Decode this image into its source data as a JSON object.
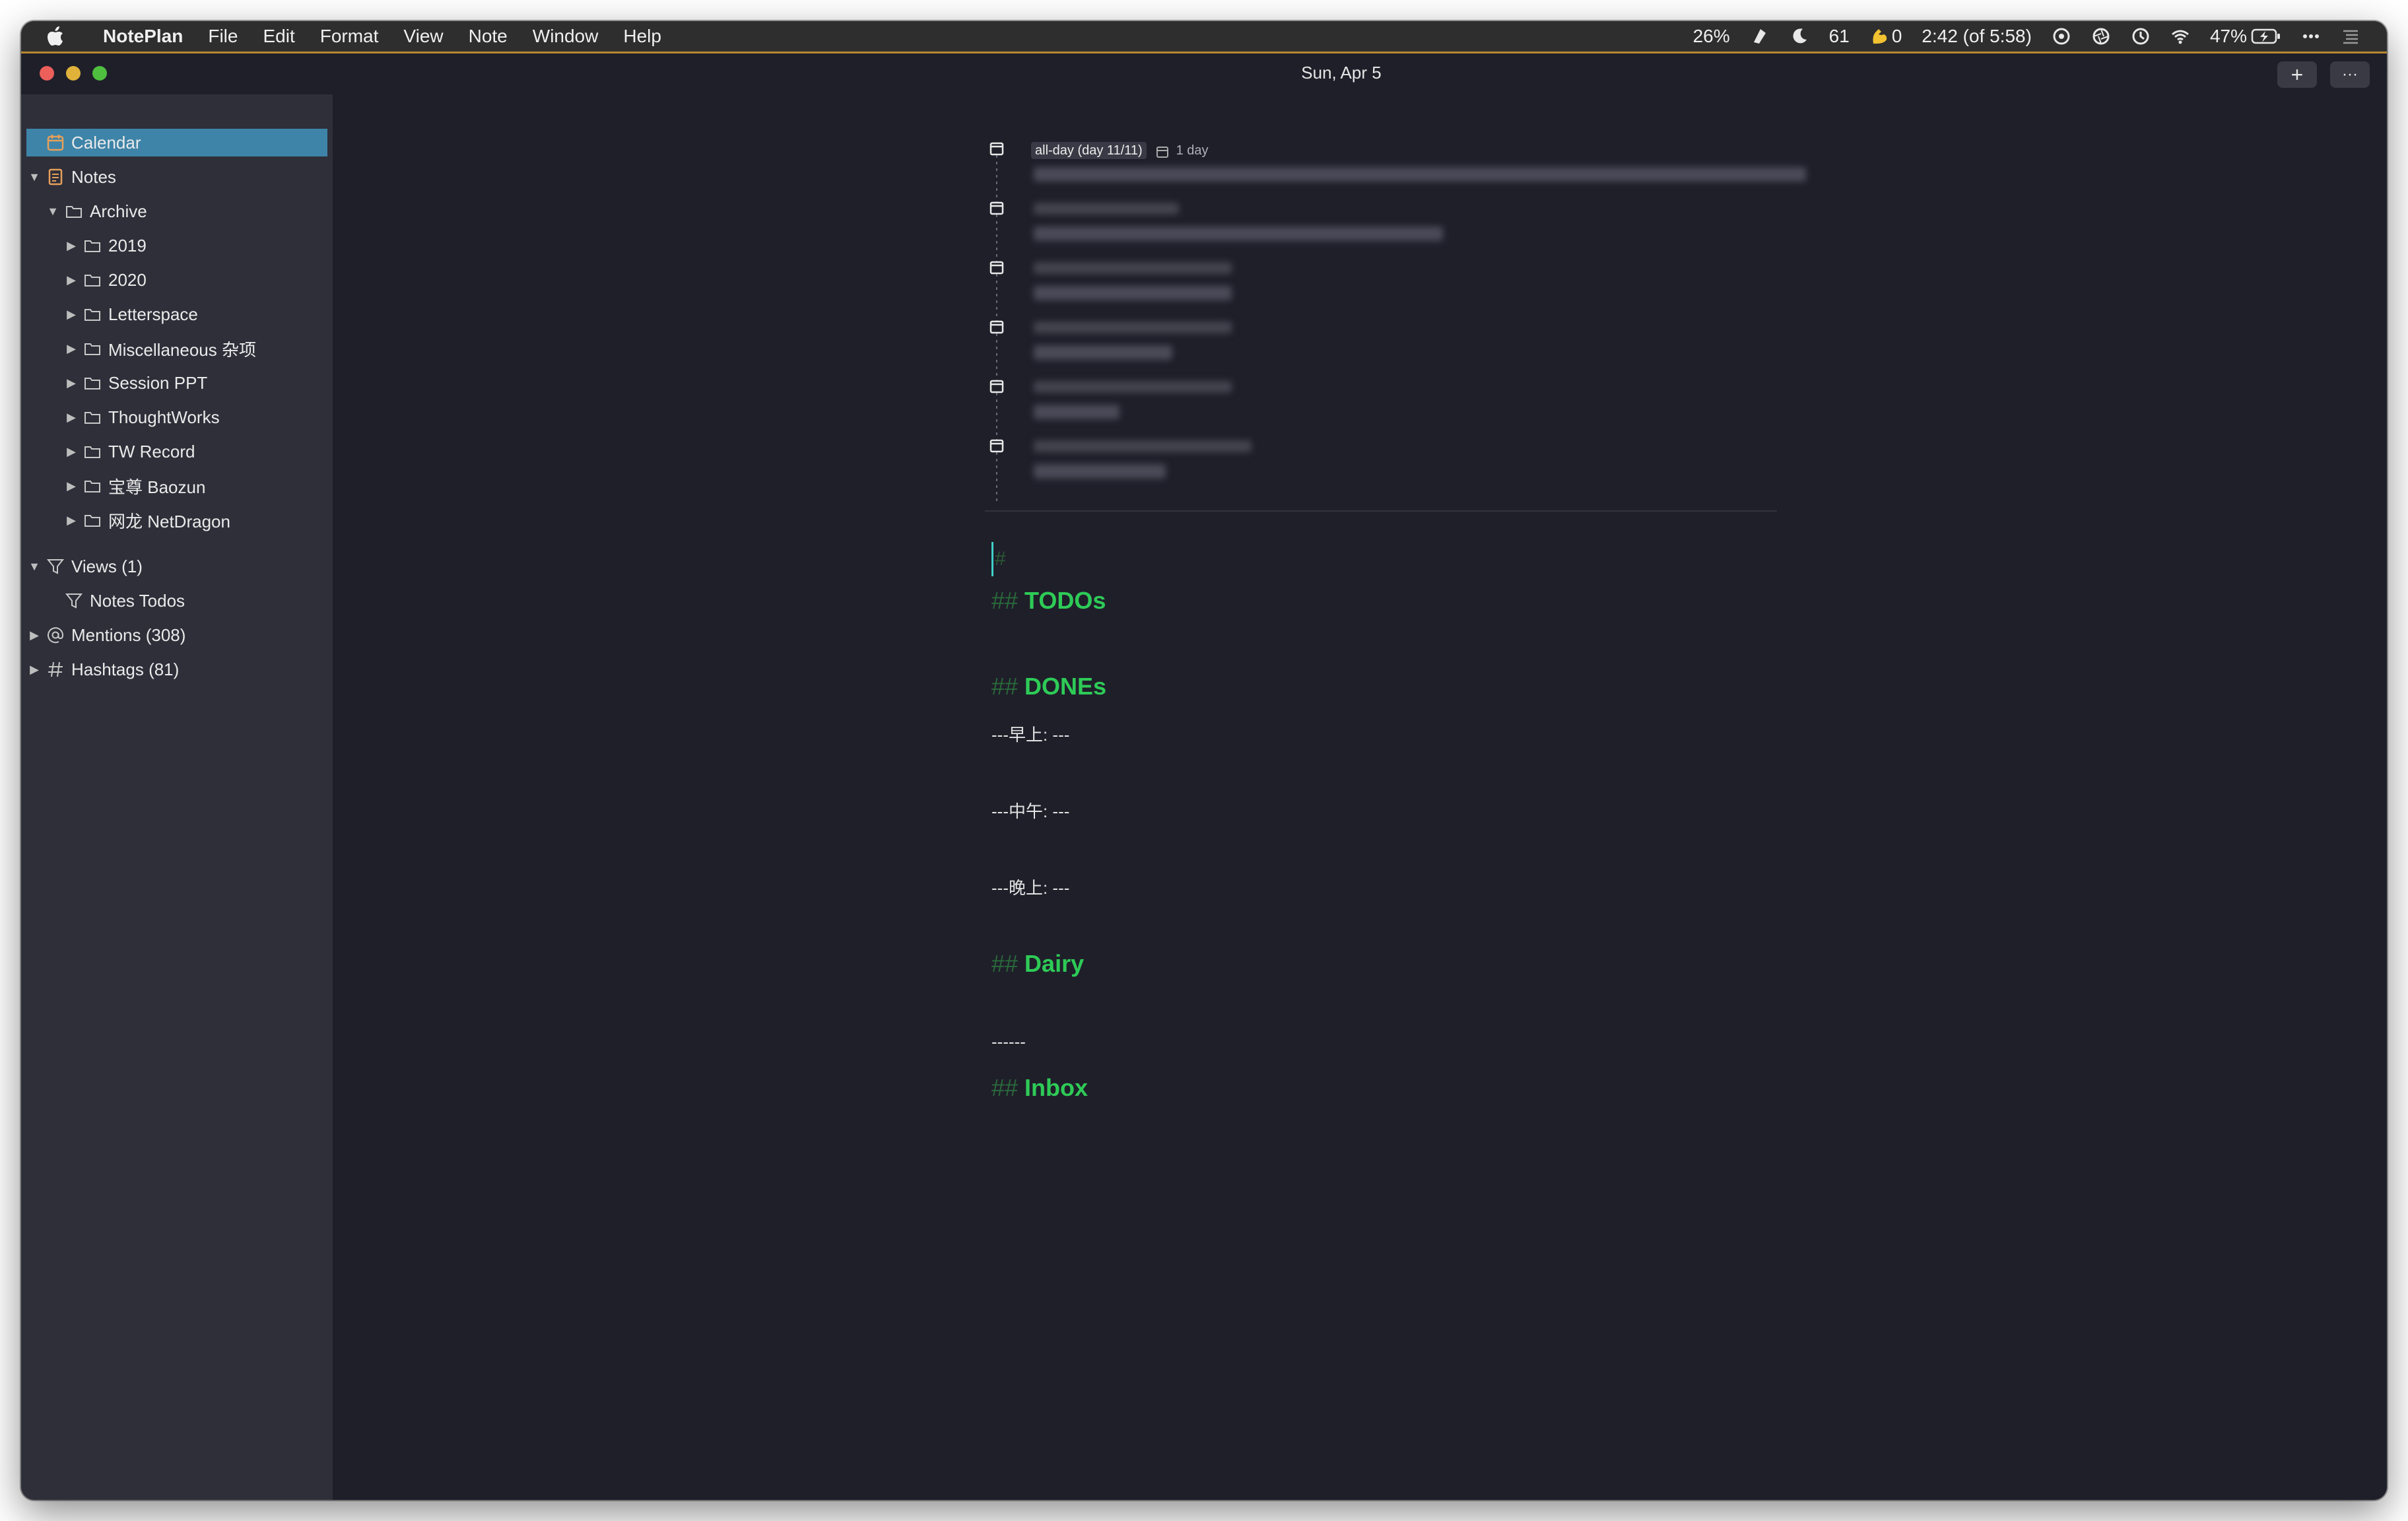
{
  "menubar": {
    "app": "NotePlan",
    "items": [
      "File",
      "Edit",
      "Format",
      "View",
      "Note",
      "Window",
      "Help"
    ],
    "status": {
      "cpu": "26%",
      "count1": "61",
      "count2": "0",
      "time": "2:42 (of 5:58)",
      "battery": "47%"
    }
  },
  "window": {
    "title": "Sun, Apr 5",
    "add_button": "+",
    "more_button": "···"
  },
  "sidebar": {
    "calendar": "Calendar",
    "notes": "Notes",
    "archive": "Archive",
    "folders": [
      "2019",
      "2020",
      "Letterspace",
      "Miscellaneous 杂项",
      "Session PPT",
      "ThoughtWorks",
      "TW Record",
      "宝尊 Baozun",
      "网龙 NetDragon"
    ],
    "views": "Views (1)",
    "notes_todos": "Notes Todos",
    "mentions": "Mentions (308)",
    "hashtags": "Hashtags (81)"
  },
  "events": {
    "first_tag": "all-day (day 11/11)",
    "first_duration": "1 day"
  },
  "editor": {
    "cursor_line": "#",
    "heading_marker": "##",
    "todos": "TODOs",
    "dones": "DONEs",
    "morning": "---早上: ---",
    "noon": "---中午: ---",
    "evening": "---晚上: ---",
    "dairy": "Dairy",
    "rule": "------",
    "inbox": "Inbox"
  },
  "colors": {
    "accent": "#3e84a8",
    "heading": "#2ecb57",
    "menubar_border": "#b8862f"
  }
}
